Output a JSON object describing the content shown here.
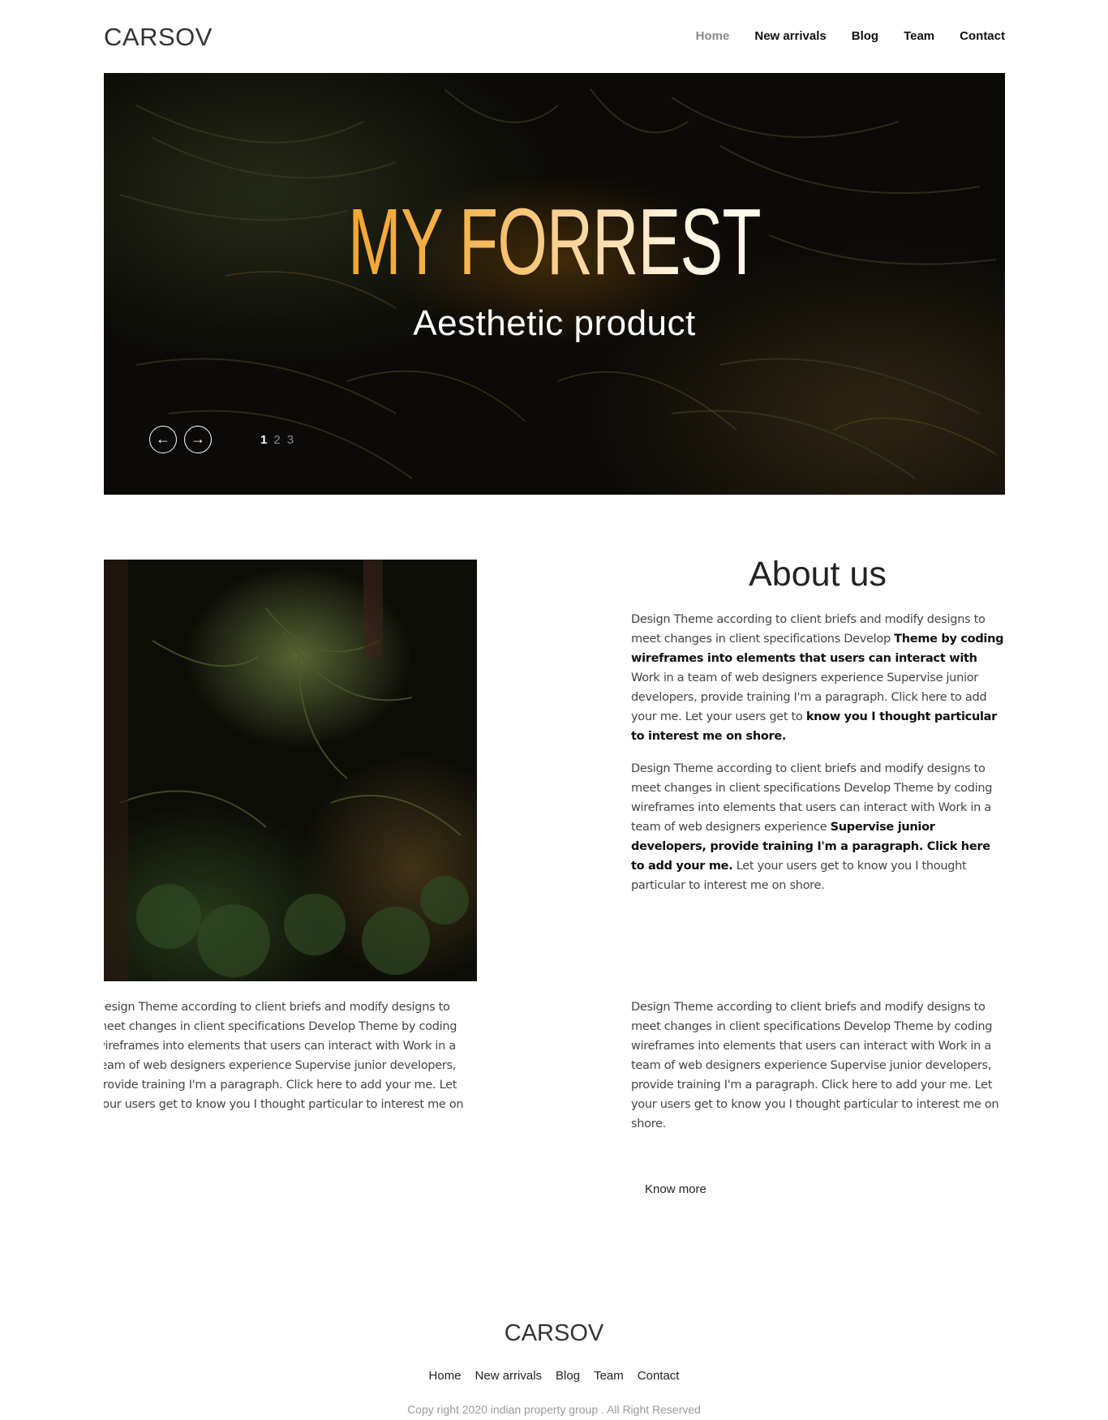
{
  "header": {
    "logo": "CARSOV",
    "nav": [
      "Home",
      "New arrivals",
      "Blog",
      "Team",
      "Contact"
    ]
  },
  "hero": {
    "title": "MY FORREST",
    "subtitle": "Aesthetic product",
    "prev_icon": "arrow-left-icon",
    "next_icon": "arrow-right-icon",
    "pages": [
      "1",
      "2",
      "3"
    ],
    "current_page": "1"
  },
  "about": {
    "title": "About us",
    "p1": [
      {
        "text": "Design Theme according to client briefs and modify designs to meet changes in client specifications Develop ",
        "bold": false
      },
      {
        "text": "Theme by coding wireframes into elements that users can interact with",
        "bold": true
      },
      {
        "text": " Work in a team of web designers experience Supervise junior developers, provide training I'm a paragraph. Click here to add your me. Let your users get to ",
        "bold": false
      },
      {
        "text": "know you I thought particular to interest me on shore.",
        "bold": true
      }
    ],
    "p2": [
      {
        "text": "Design Theme according to client briefs and modify designs to meet changes in client specifications Develop Theme by coding wireframes into elements that users can interact with Work in a team of web designers experience ",
        "bold": false
      },
      {
        "text": "Supervise junior developers, provide training I'm a paragraph. Click here to add your me.",
        "bold": true
      },
      {
        "text": " Let your users get to know you I thought particular to interest me on shore.",
        "bold": false
      }
    ],
    "p3": "Design Theme according to client briefs and modify designs to meet changes in client specifications Develop Theme by coding wireframes into elements that users can interact with Work in a team of web designers experience Supervise junior developers, provide training I'm a paragraph. Click here to add your me. Let your users get to know you I thought particular to interest me on shore.",
    "p4": "Design Theme according to client briefs and modify designs to meet changes in client specifications Develop Theme by coding wireframes into elements that users can interact with Work in a team of web designers experience Supervise junior developers, provide training I'm a paragraph. Click here to add your me. Let your users get to know you I thought particular to interest me on shore.",
    "know_more": "Know more"
  },
  "footer": {
    "logo": "CARSOV",
    "nav": [
      "Home",
      "New arrivals",
      "Blog",
      "Team",
      "Contact"
    ],
    "copyright": "Copy right 2020 indian property group . All Right Reserved"
  },
  "colors": {
    "accent_orange": "#f09a18",
    "nav_active": "#8a8a8a",
    "footer_gray": "#9a9a9a"
  }
}
